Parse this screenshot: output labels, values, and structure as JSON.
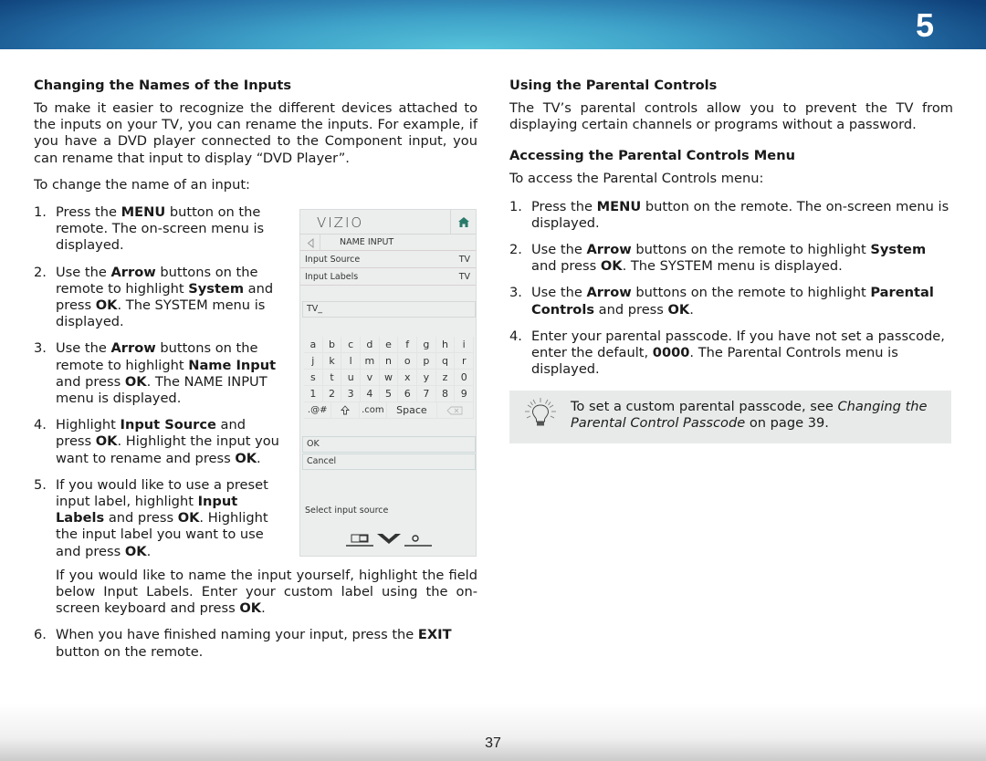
{
  "header": {
    "chapter_number": "5"
  },
  "footer": {
    "page_number": "37"
  },
  "left": {
    "heading": "Changing the Names of the Inputs",
    "intro": "To make it easier to recognize the different devices attached to the inputs on your TV, you can rename the inputs. For example, if you have a DVD player connected to the Component input, you can rename that input to display “DVD Player”.",
    "lead": "To change the name of an input:",
    "steps": [
      {
        "num": "1.",
        "parts": [
          "Press the ",
          "MENU",
          " button on the remote. The on-screen menu is displayed."
        ]
      },
      {
        "num": "2.",
        "parts": [
          "Use the ",
          "Arrow",
          " buttons on the remote to highlight ",
          "System",
          " and press ",
          "OK",
          ". The SYSTEM menu is displayed."
        ]
      },
      {
        "num": "3.",
        "parts": [
          "Use the ",
          "Arrow",
          " buttons on the remote to highlight ",
          "Name Input",
          " and press ",
          "OK",
          ". The NAME INPUT menu is displayed."
        ]
      },
      {
        "num": "4.",
        "parts": [
          "Highlight ",
          "Input Source",
          " and press ",
          "OK",
          ". Highlight the input you want to rename and press ",
          "OK",
          "."
        ]
      },
      {
        "num": "5.",
        "parts": [
          "If you would like to use a preset input label, highlight ",
          "Input Labels",
          " and press ",
          "OK",
          ". Highlight the input label you want to use and press ",
          "OK",
          "."
        ]
      }
    ],
    "step5_extra": [
      "If you would like to name the input yourself, highlight the field below Input Labels. Enter your custom label using the on-screen keyboard and press ",
      "OK",
      "."
    ],
    "step6": {
      "num": "6.",
      "parts": [
        "When you have finished naming your input, press the ",
        "EXIT",
        " button on the remote."
      ]
    }
  },
  "tv_menu": {
    "logo": "VIZIO",
    "title": "NAME INPUT",
    "rows": [
      {
        "label": "Input Source",
        "value": "TV"
      },
      {
        "label": "Input Labels",
        "value": "TV"
      }
    ],
    "field_value": "TV_",
    "keyboard": [
      [
        "a",
        "b",
        "c",
        "d",
        "e",
        "f",
        "g",
        "h",
        "i"
      ],
      [
        "j",
        "k",
        "l",
        "m",
        "n",
        "o",
        "p",
        "q",
        "r"
      ],
      [
        "s",
        "t",
        "u",
        "v",
        "w",
        "x",
        "y",
        "z",
        "0"
      ],
      [
        "1",
        "2",
        "3",
        "4",
        "5",
        "6",
        "7",
        "8",
        "9"
      ]
    ],
    "keyboard_bottom": {
      "symbols": ".@#",
      "dotcom": ".com",
      "space": "Space"
    },
    "ok_label": "OK",
    "cancel_label": "Cancel",
    "hint": "Select input source",
    "accent_color": "#2a7a6a"
  },
  "right": {
    "heading": "Using the Parental Controls",
    "intro": "The TV’s parental controls allow you to prevent the TV from displaying certain channels or programs without a password.",
    "subheading": "Accessing the Parental Controls Menu",
    "lead": "To access the Parental Controls menu:",
    "steps": [
      {
        "num": "1.",
        "parts": [
          "Press the ",
          "MENU",
          " button on the remote. The on-screen menu is displayed."
        ]
      },
      {
        "num": "2.",
        "parts": [
          "Use the ",
          "Arrow",
          " buttons on the remote to highlight ",
          "System",
          " and press ",
          "OK",
          ". The SYSTEM menu is displayed."
        ]
      },
      {
        "num": "3.",
        "parts": [
          "Use the ",
          "Arrow",
          " buttons on the remote to highlight ",
          "Parental Controls",
          " and press ",
          "OK",
          "."
        ]
      },
      {
        "num": "4.",
        "parts": [
          "Enter your parental passcode. If you have not set a passcode, enter the default, ",
          "0000",
          ". The Parental Controls menu is displayed."
        ]
      }
    ],
    "tip": {
      "icon": "lightbulb-icon",
      "text_before": "To set a custom parental passcode, see ",
      "link": "Changing the Parental Control Passcode",
      "text_after": " on page 39."
    }
  }
}
